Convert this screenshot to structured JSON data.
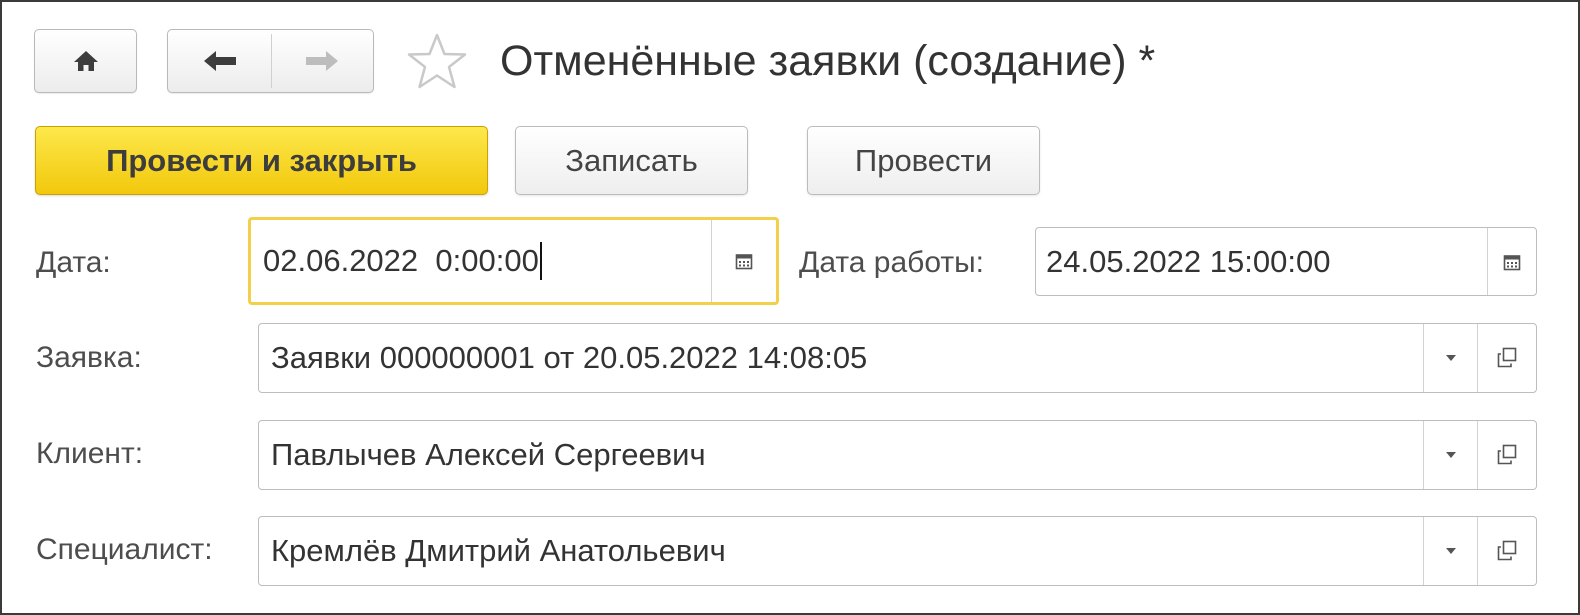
{
  "window": {
    "title": "Отменённые заявки (создание) *",
    "home_icon": "home-icon",
    "back_icon": "arrow-left-icon",
    "forward_icon": "arrow-right-icon",
    "favorite_icon": "star-icon"
  },
  "toolbar": {
    "post_and_close_label": "Провести и закрыть",
    "save_label": "Записать",
    "post_label": "Провести"
  },
  "form": {
    "date": {
      "label": "Дата:",
      "value": "02.06.2022  0:00:00"
    },
    "work_date": {
      "label": "Дата работы:",
      "value": "24.05.2022 15:00:00"
    },
    "request": {
      "label": "Заявка:",
      "value": "Заявки 000000001 от 20.05.2022 14:08:05"
    },
    "client": {
      "label": "Клиент:",
      "value": "Павлычев Алексей Сергеевич"
    },
    "specialist": {
      "label": "Специалист:",
      "value": "Кремлёв Дмитрий Анатольевич"
    }
  },
  "colors": {
    "accent_button": "#f5d020",
    "focus_border": "#f3cf4a",
    "frame_border": "#3a3a3a"
  }
}
